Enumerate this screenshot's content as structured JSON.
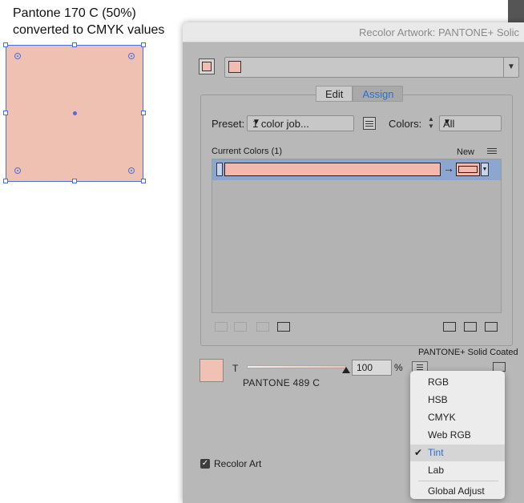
{
  "annotation": {
    "line1": "Pantone 170 C (50%)",
    "line2": "converted to CMYK values"
  },
  "artwork": {
    "fill_color": "#efc1b2",
    "selection_color": "#4a6fd8"
  },
  "dialog": {
    "title": "Recolor Artwork: PANTONE+ Solic",
    "tabs": [
      {
        "label": "Edit"
      },
      {
        "label": "Assign",
        "active": true
      }
    ],
    "preset": {
      "label": "Preset:",
      "value": "1 color job..."
    },
    "colors": {
      "label": "Colors:",
      "value": "All"
    },
    "current_colors": {
      "title": "Current Colors (1)",
      "new_label": "New"
    },
    "library_label": "PANTONE+ Solid Coated",
    "tint": {
      "label": "T",
      "value": "100",
      "unit": "%",
      "level_percent": 100
    },
    "color_name": "PANTONE 489 C",
    "recolor_art": {
      "label": "Recolor Art",
      "checked": true
    },
    "swatch_color": "#f1c1b3",
    "accent_color": "#2b6ed6"
  },
  "mode_menu": {
    "items": [
      "RGB",
      "HSB",
      "CMYK",
      "Web RGB",
      "Tint",
      "Lab",
      "Global Adjust"
    ],
    "selected": "Tint"
  }
}
